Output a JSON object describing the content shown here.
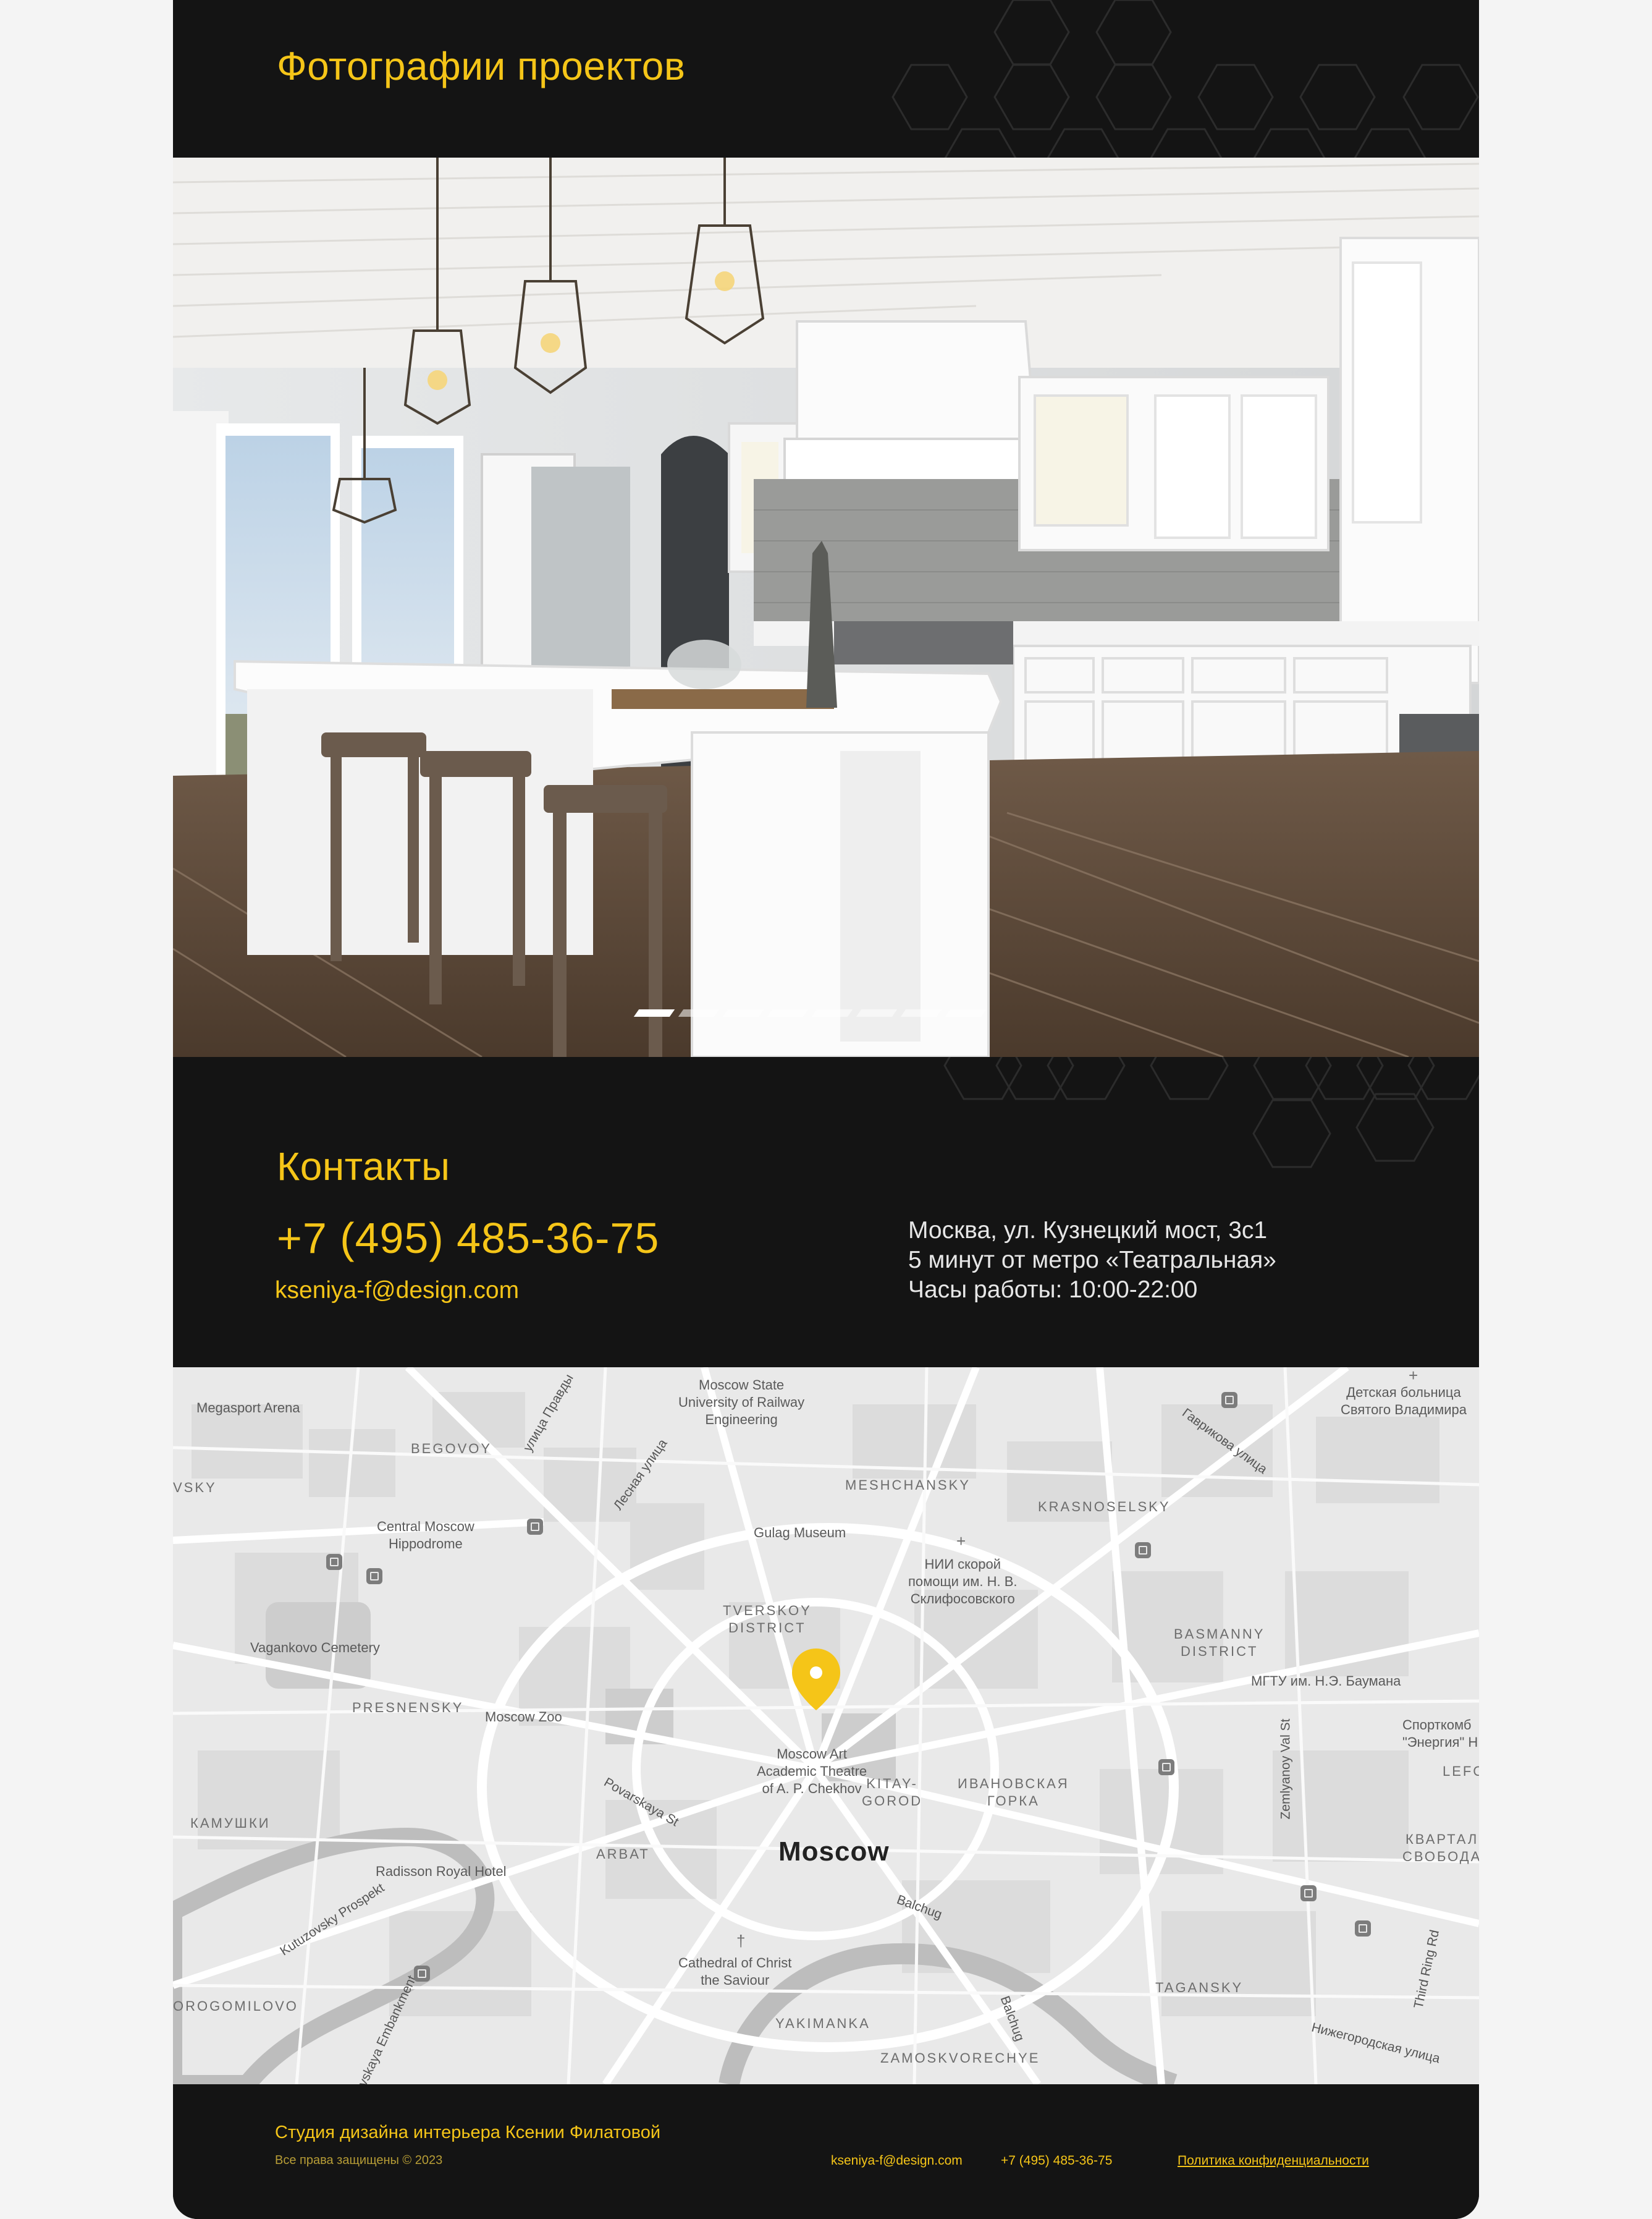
{
  "photos": {
    "title": "Фотографии проектов",
    "slider": {
      "count": 8,
      "active_index": 0
    }
  },
  "contacts": {
    "title": "Контакты",
    "phone": "+7 (495) 485-36-75",
    "email": "kseniya-f@design.com",
    "address_lines": [
      "Москва, ул. Кузнецкий мост, 3с1",
      "5 минут от метро «Театральная»",
      "Часы работы: 10:00-22:00"
    ]
  },
  "map": {
    "city": "Moscow",
    "pin_icon": "location-pin-icon",
    "pin_color": "#f5c518",
    "labels": {
      "megasport": "Megasport Arena",
      "begovoy": "BEGOVOY",
      "vsky": "VSKY",
      "ulitsa_pravdy": "улица Правды",
      "railway_uni": "Moscow State\nUniversity of Railway\nEngineering",
      "lesnaya": "Лесная улица",
      "meshchansky": "MESHCHANSKY",
      "krasnoselsky": "KRASNOSELSKY",
      "gavrikova": "Гаврикова улица",
      "hospital_vladimir": "Детская больница\nСвятого Владимира",
      "hippodrome": "Central Moscow\nHippodrome",
      "gulag": "Gulag Museum",
      "sklif": "НИИ скорой\nпомощи им. Н. В.\nСклифосовского",
      "tverskoy": "TVERSKOY\nDISTRICT",
      "basmanny": "BASMANNY\nDISTRICT",
      "vagankovo": "Vagankovo Cemetery",
      "bauman": "МГТУ им. Н.Э. Баумана",
      "presnensky": "PRESNENSKY",
      "zoo": "Moscow Zoo",
      "mkhat": "Moscow Art\nAcademic Theatre\nof A. P. Chekhov",
      "sport_complex": "Спорткомб\n\"Энергия\" НИ",
      "zemlyanoy": "Zemlyanoy Val St",
      "kitay_gorod": "KITAY-\nGOROD",
      "ivanovskaya": "ИВАНОВСКАЯ\nГОРКА",
      "lefor": "LEFOR",
      "povarskaya": "Povarskaya St",
      "kamushki": "КАМУШКИ",
      "arbat": "ARBAT",
      "kvartal": "КВАРТАЛ\nСВОБОДА",
      "radisson": "Radisson Royal Hotel",
      "balchug": "Balchug",
      "kutuzovsky": "Kutuzovsky Prospekt",
      "cathedral": "Cathedral of Christ\nthe Saviour",
      "third_ring": "Third Ring Rd",
      "dorogomilovo": "OROGOMILOVO",
      "tagansky": "TAGANSKY",
      "embankment": "vskaya Embankment",
      "yakimanka": "YAKIMANKA",
      "balchug_vertical": "Balchug",
      "nizhegorodskaya": "Нижегородская улица",
      "zamoskvorechye": "ZAMOSKVORECHYE"
    }
  },
  "footer": {
    "studio": "Студия дизайна интерьера Ксении Филатовой",
    "rights": "Все права защищены © 2023",
    "email": "kseniya-f@design.com",
    "phone": "+7 (495) 485-36-75",
    "privacy": "Политика конфиденциальности"
  }
}
